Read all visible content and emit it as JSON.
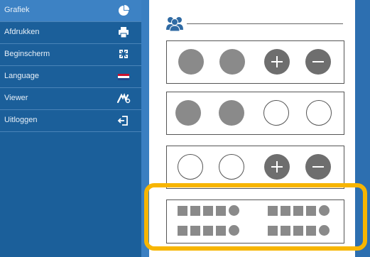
{
  "sidebar": {
    "items": [
      {
        "label": "Grafiek",
        "icon": "pie-chart-icon",
        "active": true
      },
      {
        "label": "Afdrukken",
        "icon": "printer-icon",
        "active": false
      },
      {
        "label": "Beginscherm",
        "icon": "home-screen-icon",
        "active": false
      },
      {
        "label": "Language",
        "icon": "dutch-flag-icon",
        "active": false
      },
      {
        "label": "Viewer",
        "icon": "viewer-icon",
        "active": false
      },
      {
        "label": "Uitloggen",
        "icon": "logout-icon",
        "active": false
      }
    ]
  },
  "main": {
    "header_icon": "users-icon",
    "options": [
      {
        "layout": "two-filled-plus-minus"
      },
      {
        "layout": "two-filled-two-empty"
      },
      {
        "layout": "two-empty-plus-minus"
      },
      {
        "layout": "grid-squares-dots",
        "highlighted": true
      }
    ]
  },
  "colors": {
    "sidebar": "#1b5f9a",
    "sidebar_active": "#3d82c4",
    "highlight": "#f7b500",
    "circle_filled": "#8a8a8a",
    "circle_dark": "#6e6e6e"
  }
}
